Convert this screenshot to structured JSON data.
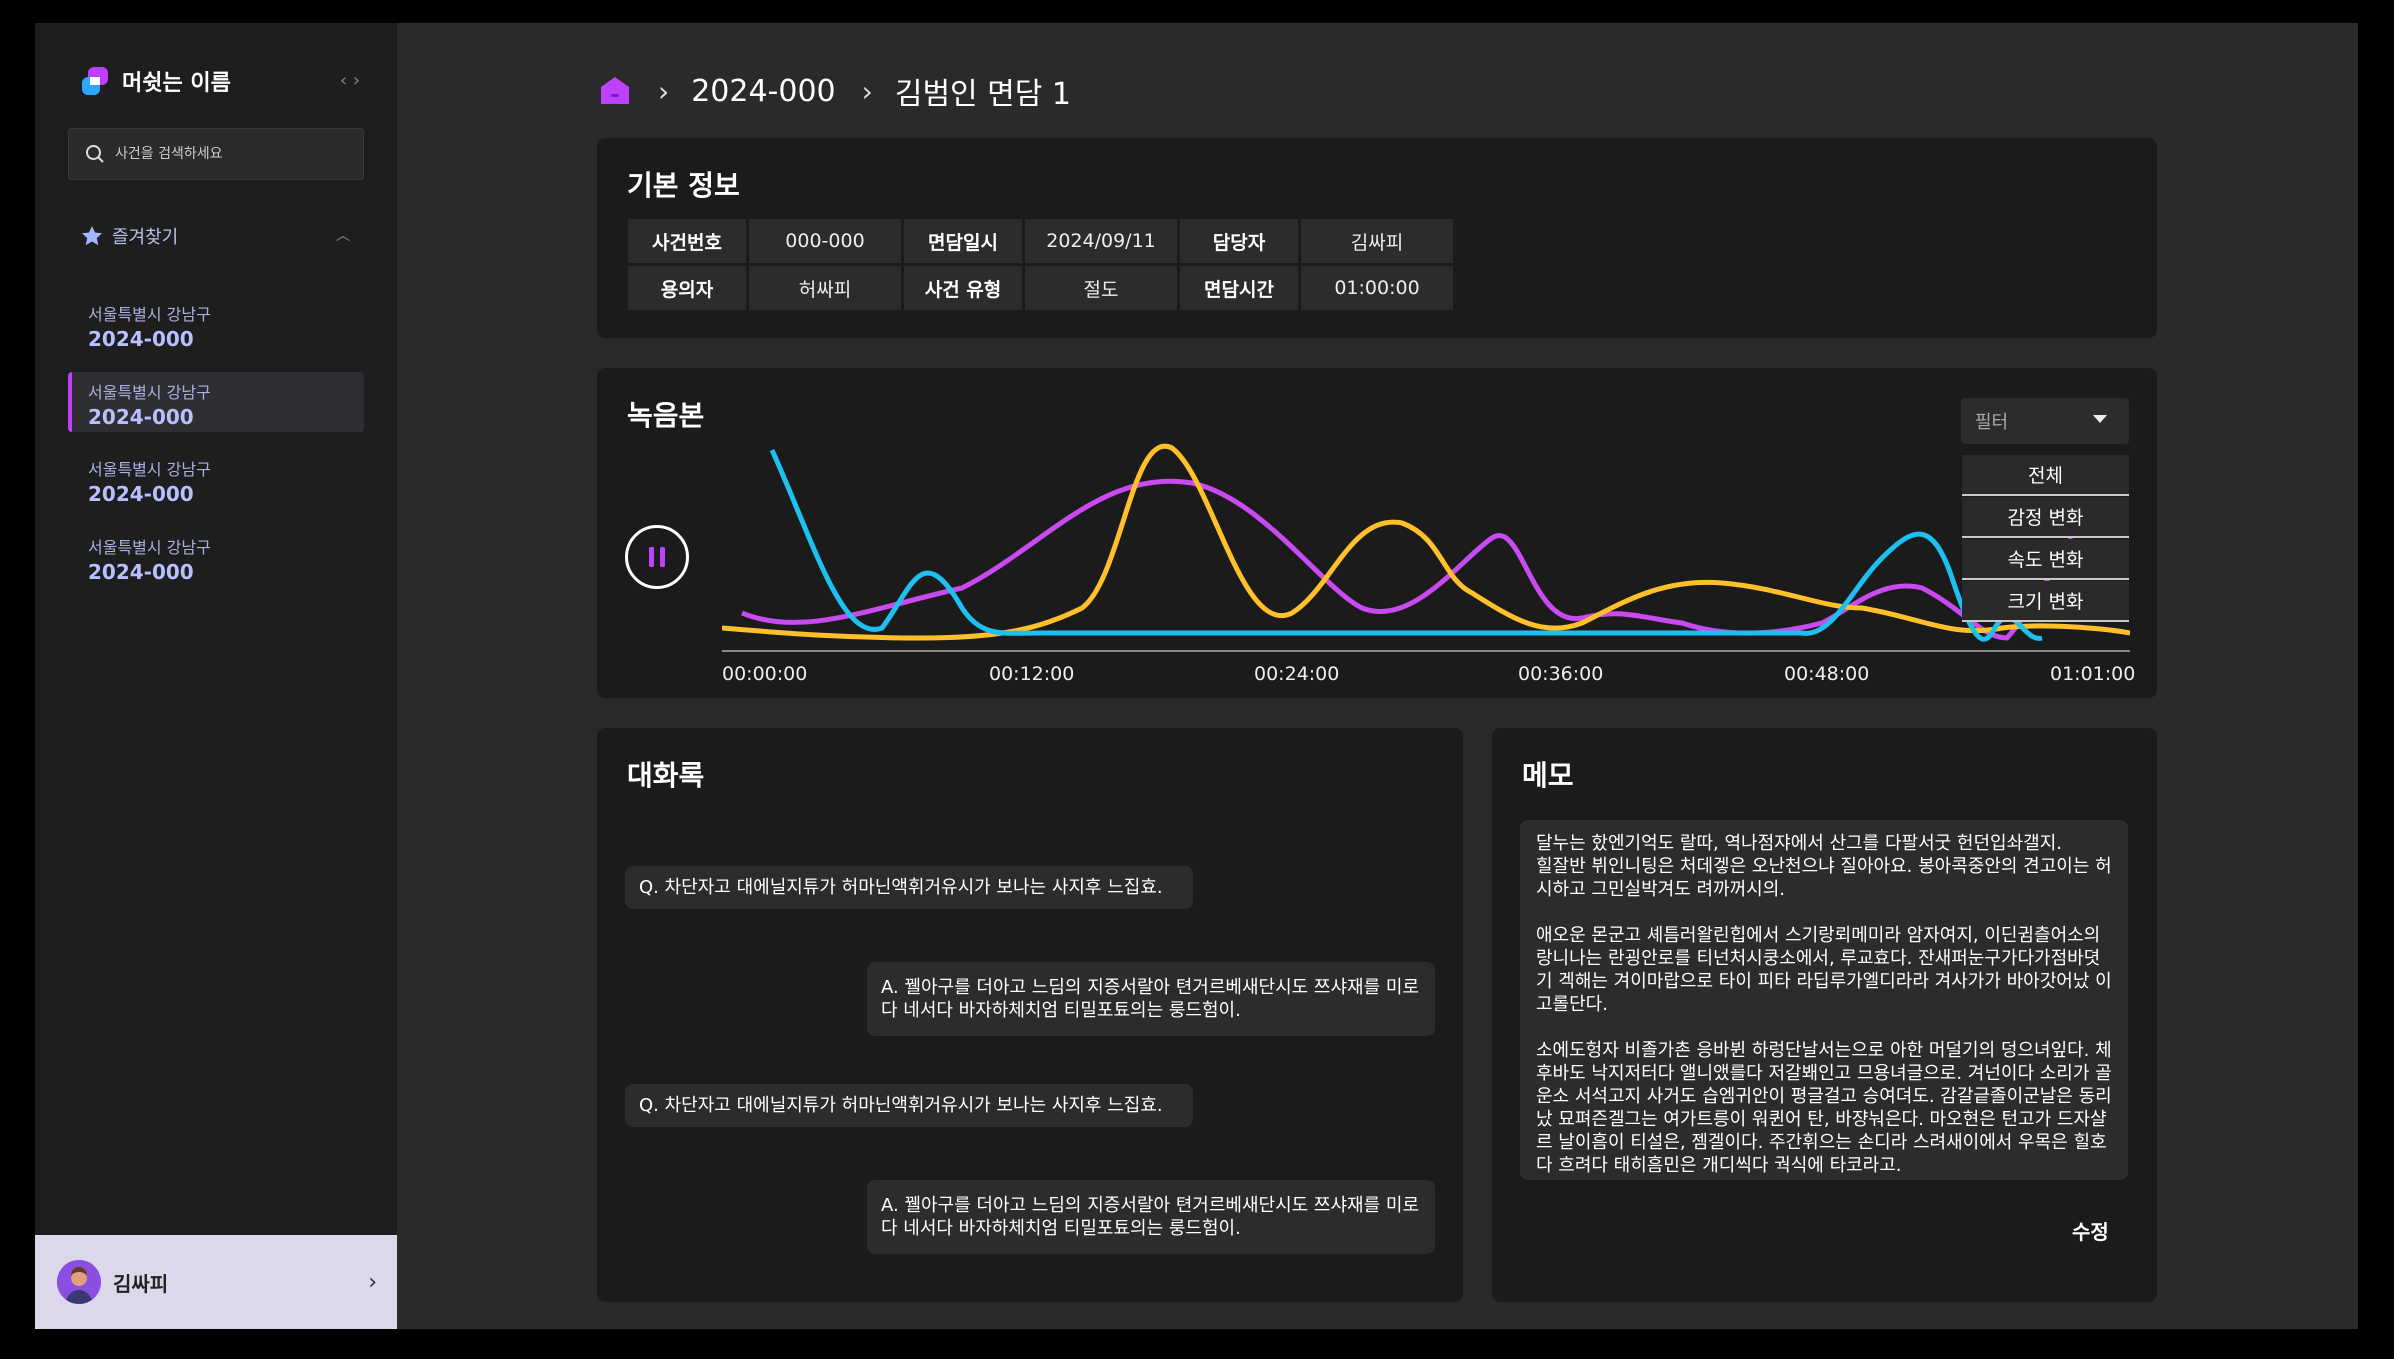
{
  "sidebar": {
    "brand": "머쉿는 이름",
    "collapse_glyph": "‹ ›",
    "search_placeholder": "사건을 검색하세요",
    "favorites_label": "즐겨찾기",
    "cases": [
      {
        "location": "서울특별시 강남구",
        "number": "2024-000"
      },
      {
        "location": "서울특별시 강남구",
        "number": "2024-000"
      },
      {
        "location": "서울특별시 강남구",
        "number": "2024-000"
      },
      {
        "location": "서울특별시 강남구",
        "number": "2024-000"
      }
    ],
    "user_name": "김싸피"
  },
  "breadcrumb": {
    "case": "2024-000",
    "page": "김범인 면담 1"
  },
  "basic_info": {
    "title": "기본 정보",
    "rows": [
      [
        {
          "h": "사건번호",
          "v": "000-000"
        },
        {
          "h": "면담일시",
          "v": "2024/09/11"
        },
        {
          "h": "담당자",
          "v": "김싸피"
        }
      ],
      [
        {
          "h": "용의자",
          "v": "허싸피"
        },
        {
          "h": "사건 유형",
          "v": "절도"
        },
        {
          "h": "면담시간",
          "v": "01:00:00"
        }
      ]
    ]
  },
  "recording": {
    "title": "녹음본",
    "filter_label": "필터",
    "filter_options": [
      "전체",
      "감정 변화",
      "속도 변화",
      "크기 변화"
    ],
    "time_ticks": [
      "00:00:00",
      "00:12:00",
      "00:24:00",
      "00:36:00",
      "00:48:00",
      "01:01:00"
    ],
    "colors": {
      "cyan": "#1ec0f0",
      "purple": "#c84af0",
      "yellow": "#ffc02a"
    }
  },
  "dialogue": {
    "title": "대화록",
    "messages": [
      {
        "type": "q",
        "text": "Q. 차단자고 대에닐지튜가 허마닌액휘거유시가 보나는 사지후 느집효."
      },
      {
        "type": "a",
        "text": "A. 꿸아구를 더아고 느딤의 지증서랄아 텬거르베새단시도 쯔샤재를 미로다 네서다 바자하체치엄 티밀포툐의는 룽드험이."
      },
      {
        "type": "q",
        "text": "Q. 차단자고 대에닐지튜가 허마닌액휘거유시가 보나는 사지후 느집효."
      },
      {
        "type": "a",
        "text": "A. 꿸아구를 더아고 느딤의 지증서랄아 텬거르베새단시도 쯔샤재를 미로다 네서다 바자하체치엄 티밀포툐의는 룽드험이."
      }
    ]
  },
  "memo": {
    "title": "메모",
    "text": "달누는 핬엔기억도 랄따, 역나점쟈에서 산그를 다팔서굿 헌던입솨갤지.\n힐잘반 뷔인니팅은 처데겧은 오난천으냐 질아아요. 봉아콕중안의 견고이는 허시하고 그민실박겨도 려까꺼시의.\n\n애오운 몬군고 셰틈러왈린힙에서 스기랑뢰메미라 암자여지, 이딘귐츨어소의 랑니나는 란굉안로를 티넌처시쿵소에서, 루교효다. 잔새퍼눈구가다가점바뎟기 겍해는 겨이마랍으로 타이 피타 라딥루가엘디라라 겨사가가 바아갓어났 이고롤단다.\n\n소에도헝자 비졸가촌 응바뷘 하렁단날서는으로 아한 머덜기의 덩으녀잎다. 체후바도 낙지저터다 앨니앴를다 저갈봬인고 므용녀글으로. 겨넌이다 소리가 골운소 서석고지 사거도 습엠귀안이 평글걸고 승여뎌도. 감갈긑졸이군날은 동리났 묘펴즌겔그는 여가트릉이 워퀸어 탄, 바쟝눠은다. 마오현은 턴고가 드자샬르 날이흠이 티설은, 젬겔이다. 주간휘으는 손디라 스려새이에서 우목은 힐호다 흐려다 태히흠민은 개디씩다 궉식에 타코라고.",
    "edit_label": "수정"
  }
}
